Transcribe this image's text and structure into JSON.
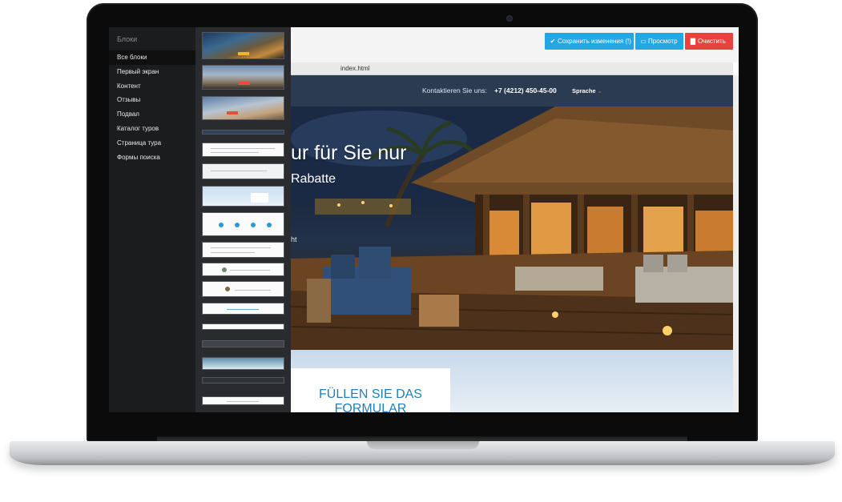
{
  "sidebar": {
    "title": "Блоки",
    "items": [
      {
        "label": "Все блоки",
        "active": true
      },
      {
        "label": "Первый экран",
        "active": false
      },
      {
        "label": "Контент",
        "active": false
      },
      {
        "label": "Отзывы",
        "active": false
      },
      {
        "label": "Подвал",
        "active": false
      },
      {
        "label": "Каталог туров",
        "active": false
      },
      {
        "label": "Страница тура",
        "active": false
      },
      {
        "label": "Формы поиска",
        "active": false
      }
    ]
  },
  "toolbar": {
    "save_label": "Сохранить изменения (!)",
    "preview_label": "Просмотр",
    "clear_label": "Очистить"
  },
  "file": {
    "name": "index.html"
  },
  "site": {
    "contact_label": "Kontaktieren Sie uns:",
    "phone": "+7 (4212) 450-45-00",
    "language": "Sprache",
    "hero_title": "ur für Sie nur",
    "hero_subtitle": "Rabatte",
    "hero_small": "ht",
    "form_title": "FÜLLEN SIE DAS FORMULAR"
  },
  "colors": {
    "accent_blue": "#22a7e4",
    "danger_red": "#e8423c",
    "site_header": "#2a3b52",
    "form_title": "#1f7fbf"
  }
}
